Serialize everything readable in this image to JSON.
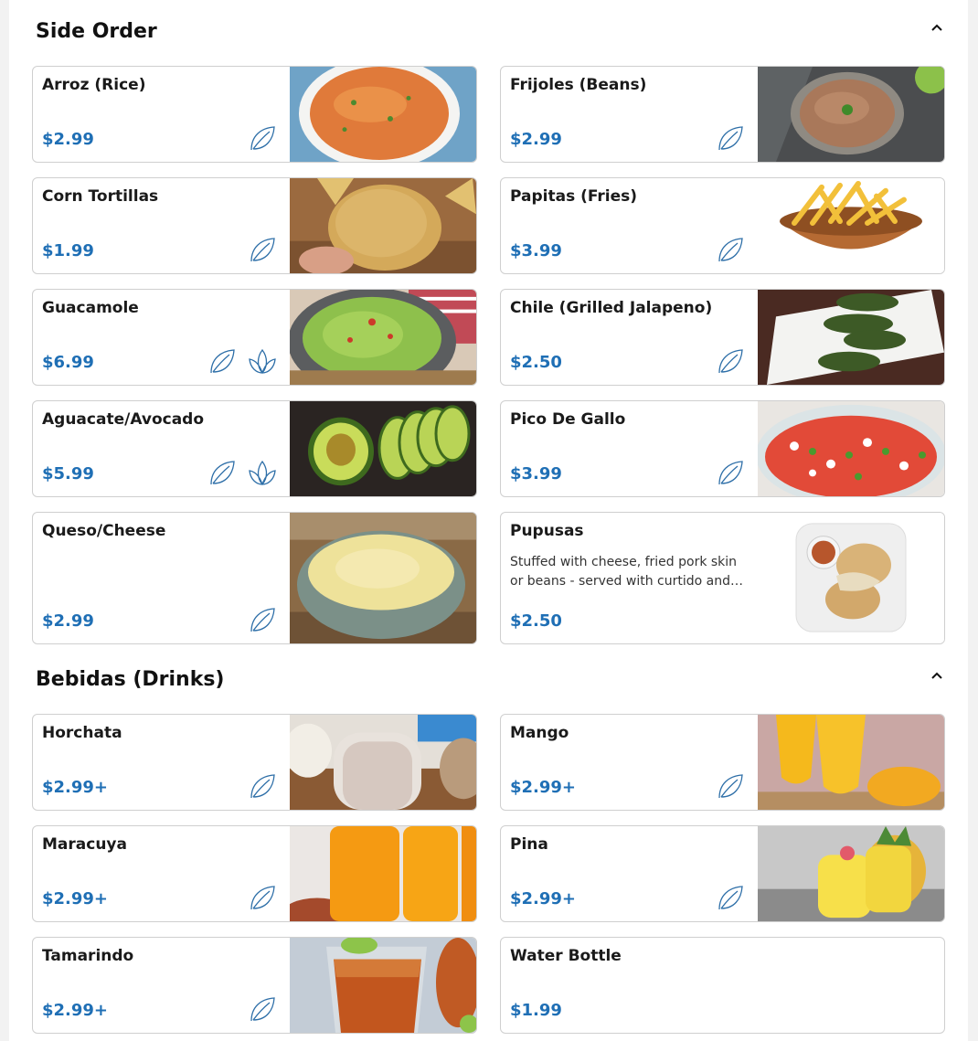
{
  "sections": [
    {
      "title": "Side Order",
      "items": [
        {
          "name": "Arroz (Rice)",
          "price": "$2.99"
        },
        {
          "name": "Frijoles (Beans)",
          "price": "$2.99"
        },
        {
          "name": "Corn Tortillas",
          "price": "$1.99"
        },
        {
          "name": "Papitas (Fries)",
          "price": "$3.99"
        },
        {
          "name": "Guacamole",
          "price": "$6.99"
        },
        {
          "name": "Chile (Grilled Jalapeno)",
          "price": "$2.50"
        },
        {
          "name": "Aguacate/Avocado",
          "price": "$5.99"
        },
        {
          "name": "Pico De Gallo",
          "price": "$3.99"
        },
        {
          "name": "Queso/Cheese",
          "price": "$2.99"
        },
        {
          "name": "Pupusas",
          "description": "Stuffed with cheese, fried pork skin or beans - served with curtido and…",
          "price": "$2.50"
        }
      ]
    },
    {
      "title": "Bebidas (Drinks)",
      "items": [
        {
          "name": "Horchata",
          "price": "$2.99+"
        },
        {
          "name": "Mango",
          "price": "$2.99+"
        },
        {
          "name": "Maracuya",
          "price": "$2.99+"
        },
        {
          "name": "Pina",
          "price": "$2.99+"
        },
        {
          "name": "Tamarindo",
          "price": "$2.99+"
        },
        {
          "name": "Water Bottle",
          "price": "$1.99"
        }
      ]
    }
  ],
  "icons": {
    "collapse": "chevron-up-icon",
    "vegetarian": "leaf-icon",
    "vegan": "sprout-icon"
  },
  "colors": {
    "price": "#1f6fb5",
    "icon_stroke": "#2e6fa8",
    "border": "#cfcfcf"
  }
}
